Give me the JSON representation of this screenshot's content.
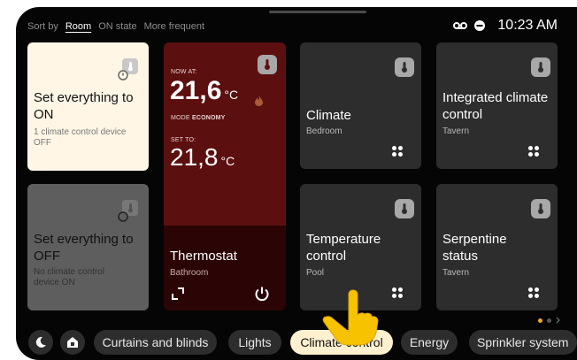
{
  "sort": {
    "label": "Sort by",
    "options": [
      "Room",
      "ON state",
      "More frequent"
    ],
    "selected": "Room"
  },
  "status_bar": {
    "time": "10:23 AM",
    "icons": [
      "voicemail-icon",
      "do-not-disturb-icon"
    ]
  },
  "cards": {
    "all_on": {
      "title": "Set everything to ON",
      "sub": "1 climate control device OFF",
      "icon": "thermometer-icon"
    },
    "all_off": {
      "title": "Set everything to OFF",
      "sub": "No climate control device ON",
      "icon": "thermometer-icon"
    },
    "thermostat": {
      "now_label": "NOW AT:",
      "now_value": "21,6",
      "unit": "°C",
      "mode_label": "MODE",
      "mode_value": "ECONOMY",
      "set_label": "SET TO:",
      "set_value": "21,8",
      "title": "Thermostat",
      "sub": "Bathroom"
    },
    "climate": {
      "title": "Climate",
      "sub": "Bedroom"
    },
    "integrated": {
      "title": "Integrated climate control",
      "sub": "Tavern"
    },
    "temperature": {
      "title": "Temperature control",
      "sub": "Pool"
    },
    "serpentine": {
      "title": "Serpentine status",
      "sub": "Tavern"
    }
  },
  "categories": [
    "Curtains and blinds",
    "Lights",
    "Climate control",
    "Energy",
    "Sprinkler system"
  ],
  "selected_category": "Climate control",
  "pager": {
    "pages": 3,
    "current": 1
  },
  "colors": {
    "accent": "#f3a71e",
    "thermostat_bg": "#5c0f0f",
    "active_pill": "#fff0cf"
  }
}
